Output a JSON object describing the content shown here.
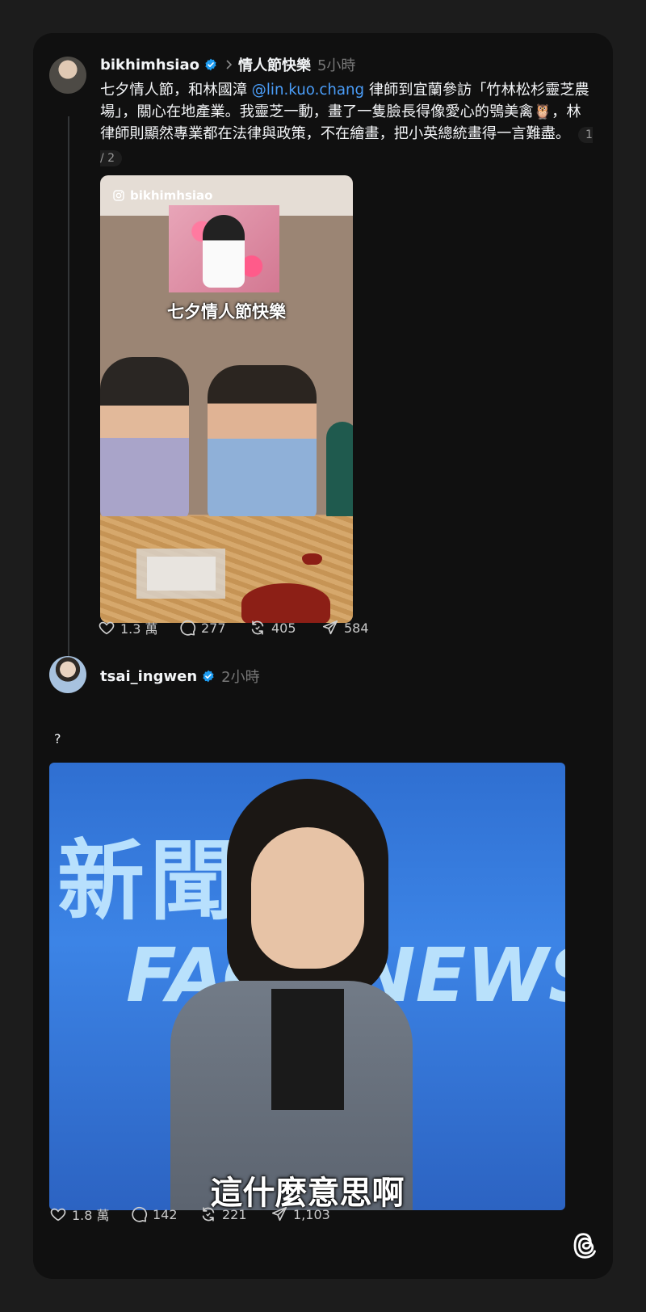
{
  "post1": {
    "username": "bikhimhsiao",
    "topic": "情人節快樂",
    "time": "5小時",
    "text_before": "七夕情人節，和林國漳 ",
    "mention": "@lin.kuo.chang",
    "text_after": " 律師到宜蘭參訪「竹林松杉靈芝農場」，關心在地產業。我靈芝一動，畫了一隻臉長得像愛心的鴞美禽🦉，林律師則顯然專業都在法律與政策，不在繪畫，把小英總統畫得一言難盡。",
    "pager": "1 / 2",
    "media": {
      "ig_handle": "bikhimhsiao",
      "caption": "七夕情人節快樂"
    },
    "likes": "1.3 萬",
    "replies": "277",
    "reposts": "405",
    "shares": "584"
  },
  "post2": {
    "username": "tsai_ingwen",
    "time": "2小時",
    "text": "?",
    "media": {
      "news_title": "新聞",
      "news_title_2": "FACT NEWS",
      "subtitle": "這什麼意思啊"
    },
    "likes": "1.8 萬",
    "replies": "142",
    "reposts": "221",
    "shares": "1,103"
  },
  "icons": {
    "verified": "verified-badge-icon",
    "chevron": "chevron-right-icon",
    "like": "heart-icon",
    "reply": "comment-icon",
    "repost": "repost-icon",
    "share": "send-icon",
    "brand": "threads-logo-icon"
  },
  "colors": {
    "background": "#101010",
    "mention": "#4a9df8",
    "verified": "#1d9bf0"
  }
}
